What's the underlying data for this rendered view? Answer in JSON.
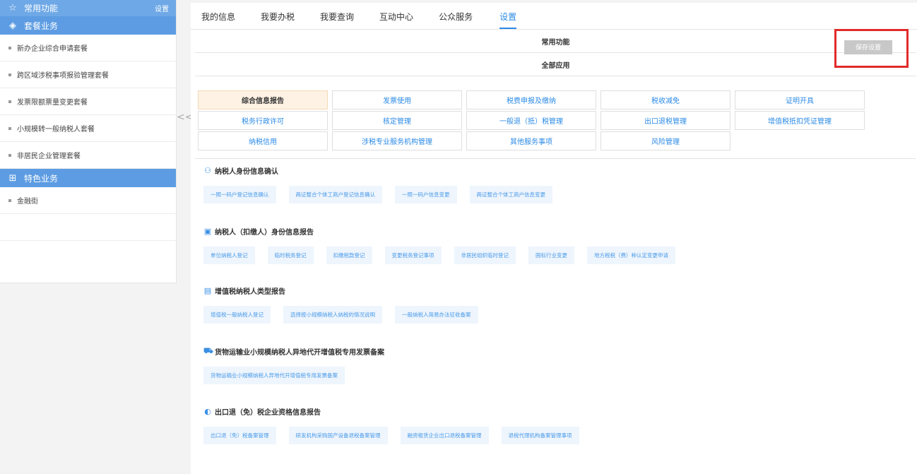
{
  "sidebar": {
    "common_label": "常用功能",
    "settings_label": "设置",
    "packages_label": "套餐业务",
    "package_items": [
      "新办企业综合申请套餐",
      "跨区域涉税事项报验管理套餐",
      "发票限额票量变更套餐",
      "小规模转一般纳税人套餐",
      "非居民企业管理套餐"
    ],
    "features_label": "特色业务",
    "feature_items": [
      "金融街"
    ],
    "collapse_glyph": "<<"
  },
  "tabs": [
    "我的信息",
    "我要办税",
    "我要查询",
    "互动中心",
    "公众服务",
    "设置"
  ],
  "active_tab": "设置",
  "section": {
    "common_title": "常用功能",
    "all_apps_title": "全部应用",
    "save_label": "保存设置"
  },
  "categories": [
    "综合信息报告",
    "发票使用",
    "税费申报及缴纳",
    "税收减免",
    "证明开具",
    "税务行政许可",
    "核定管理",
    "一般退（抵）税管理",
    "出口退税管理",
    "增值税抵扣凭证管理",
    "纳税信用",
    "涉税专业服务机构管理",
    "其他服务事项",
    "风险管理"
  ],
  "groups": [
    {
      "title": "纳税人身份信息确认",
      "icon": "user-icon",
      "items": [
        "一照一码户登记信息确认",
        "两证整合个体工商户登记信息确认",
        "一照一码户信息变更",
        "两证整合个体工商户信息变更"
      ]
    },
    {
      "title": "纳税人（扣缴人）身份信息报告",
      "icon": "id-card-icon",
      "items": [
        "单位纳税人登记",
        "临时税务登记",
        "扣缴税款登记",
        "变更税务登记事项",
        "非居民组织临时登记",
        "国标行业变更",
        "地方税税（费）种认定变更申请"
      ]
    },
    {
      "title": "增值税纳税人类型报告",
      "icon": "document-icon",
      "items": [
        "增值税一般纳税人登记",
        "选择按小规模纳税人纳税的情况说明",
        "一般纳税人简易办法征收备案"
      ]
    },
    {
      "title": "货物运输业小规模纳税人异地代开增值税专用发票备案",
      "icon": "truck-icon",
      "items": [
        "货物运输业小规模纳税人异地代开增值税专用发票备案"
      ]
    },
    {
      "title": "出口退（免）税企业资格信息报告",
      "icon": "globe-icon",
      "items": [
        "出口退（免）税备案管理",
        "研发机构采购国产设备退税备案管理",
        "融资租赁企业出口退税备案管理",
        "退税代理机构备案管理事项"
      ]
    }
  ],
  "colors": {
    "accent": "#2b8ae6",
    "sidebar_header": "#6ea8e6",
    "highlight": "#e12b2b"
  }
}
